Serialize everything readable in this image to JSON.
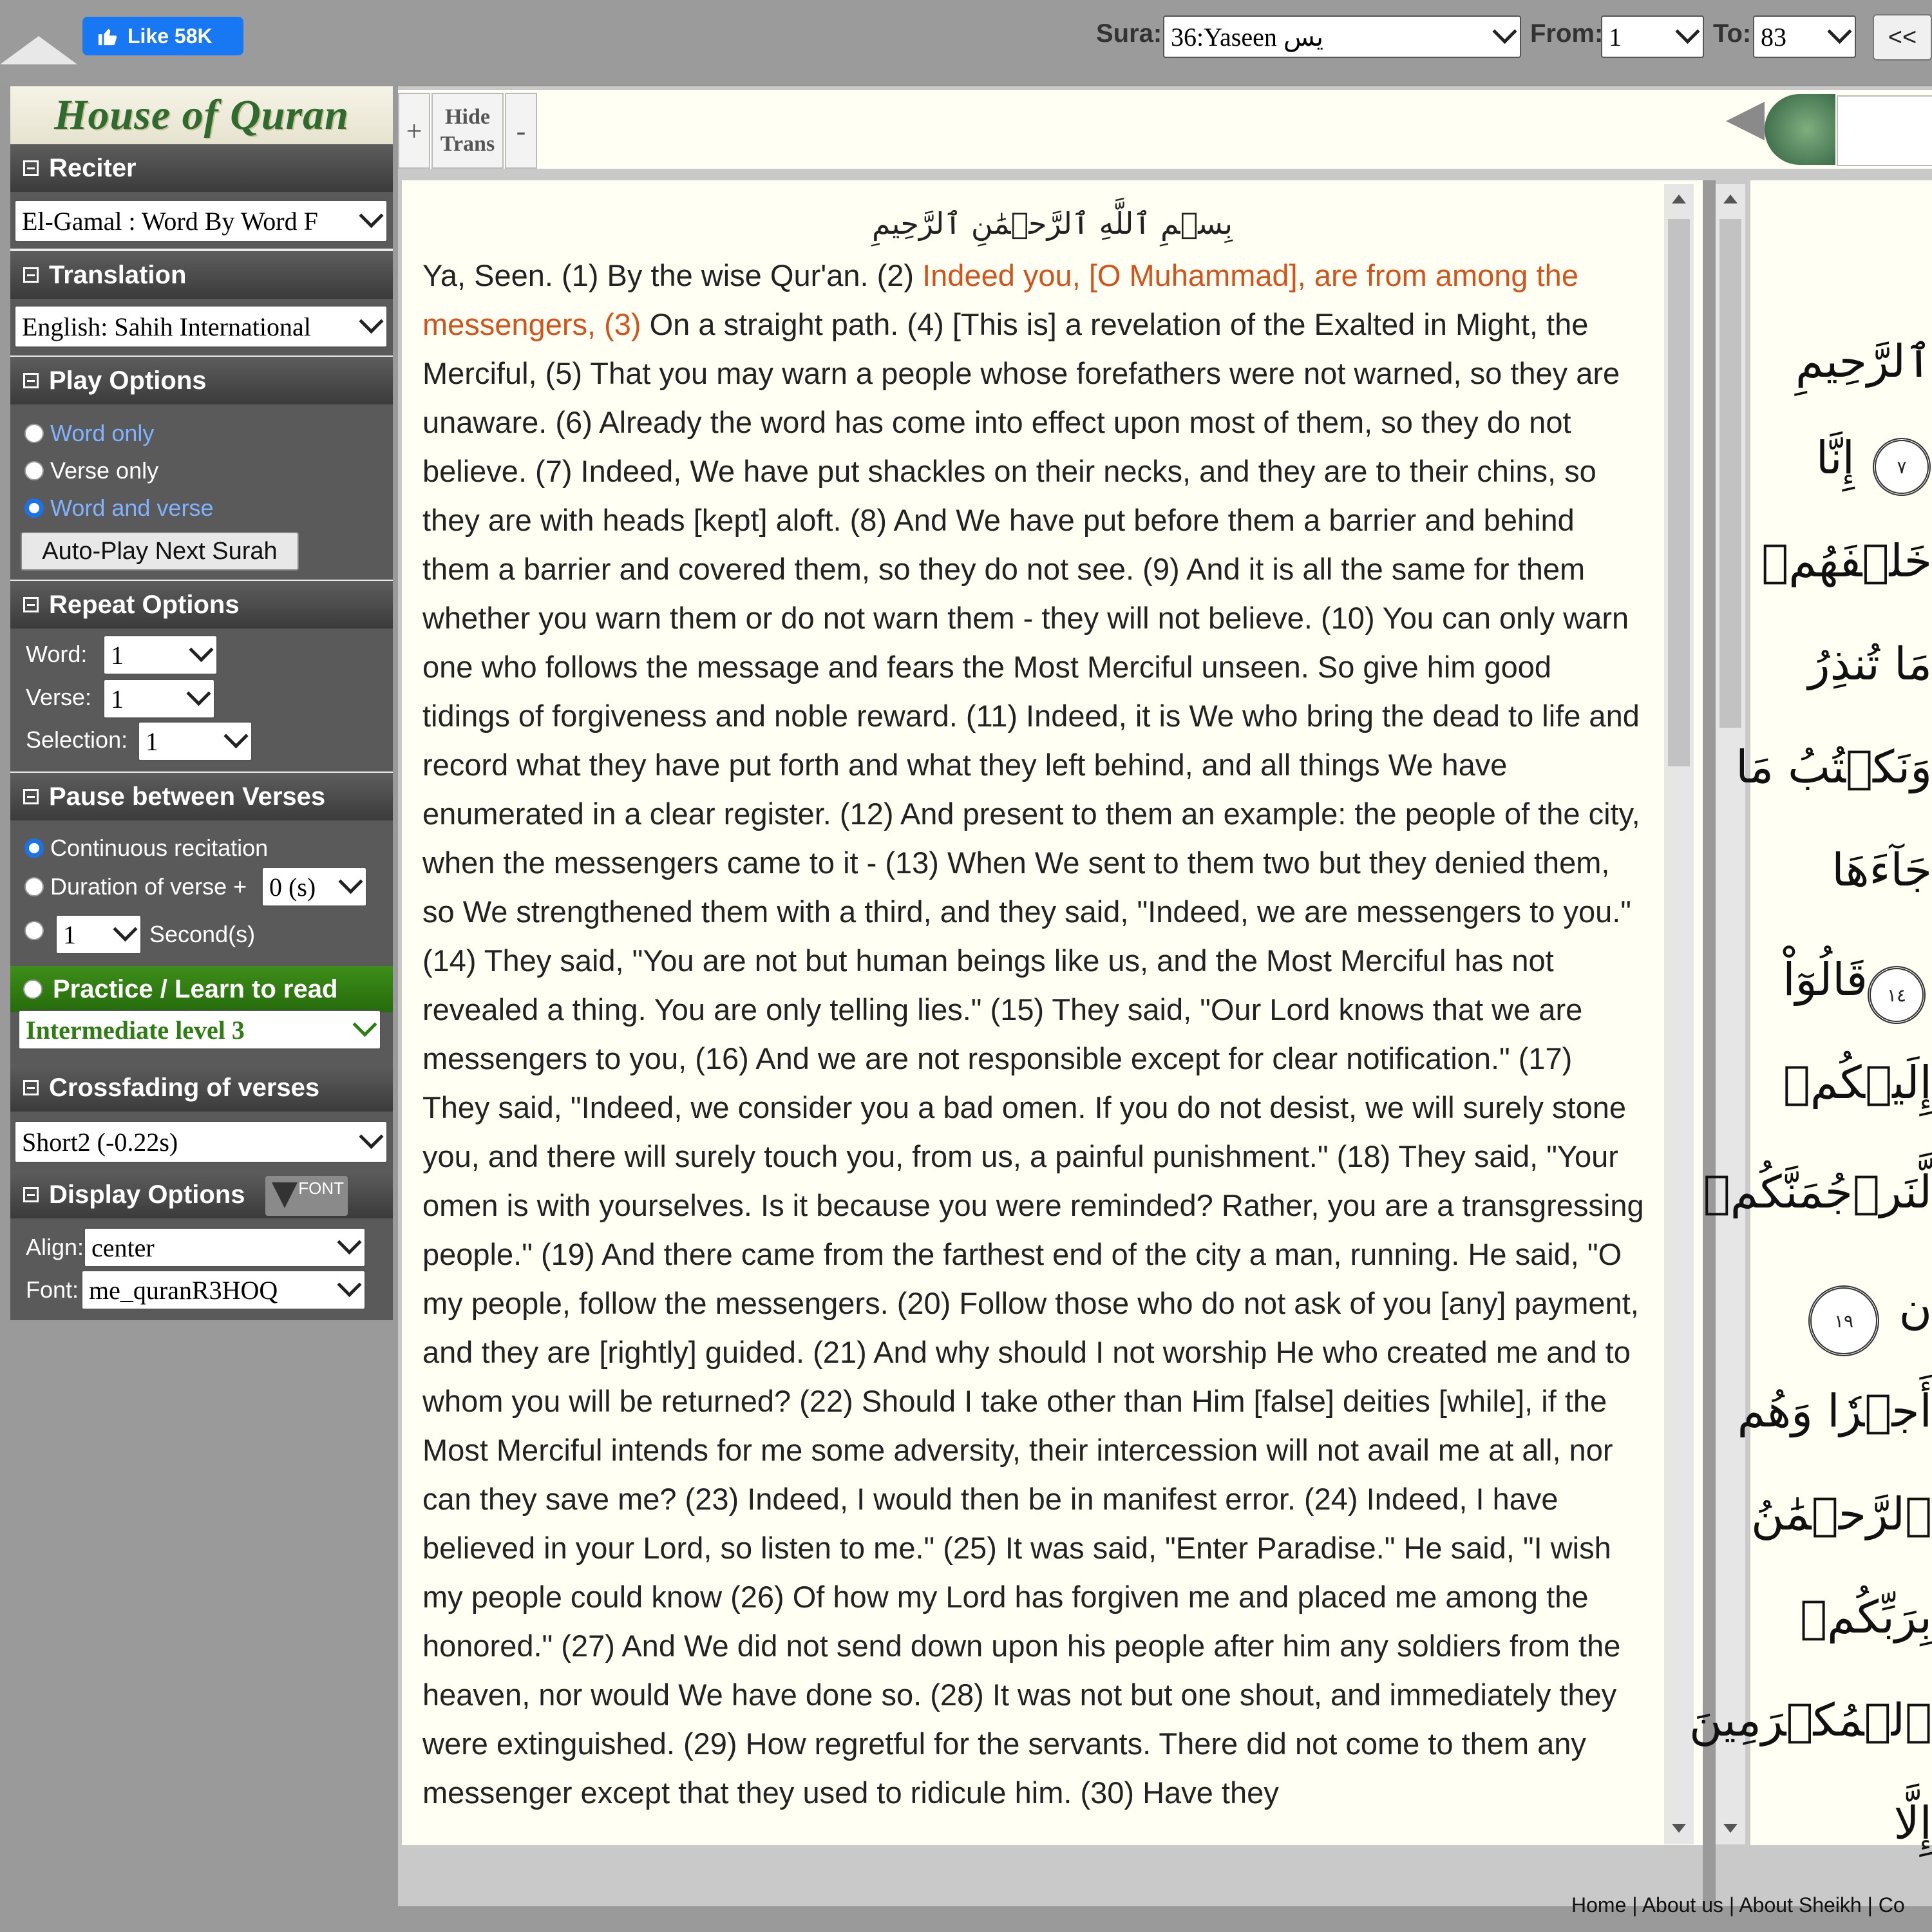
{
  "topbar": {
    "like_label": "Like 58K",
    "sura_label": "Sura:",
    "sura_value": "36:Yaseen يس",
    "from_label": "From:",
    "from_value": "1",
    "to_label": "To:",
    "to_value": "83",
    "prev_label": "<<"
  },
  "sidebar": {
    "logo": "House of Quran",
    "reciter": {
      "title": "Reciter",
      "value": "El-Gamal : Word By Word F"
    },
    "translation": {
      "title": "Translation",
      "value": "English: Sahih International"
    },
    "play": {
      "title": "Play Options",
      "options": [
        "Word only",
        "Verse only",
        "Word and verse"
      ],
      "autoplay": "Auto-Play Next Surah"
    },
    "repeat": {
      "title": "Repeat Options",
      "word_label": "Word:",
      "word_value": "1",
      "verse_label": "Verse:",
      "verse_value": "1",
      "selection_label": "Selection:",
      "selection_value": "1"
    },
    "pause": {
      "title": "Pause between Verses",
      "continuous": "Continuous recitation",
      "duration": "Duration of verse +",
      "duration_value": "0 (s)",
      "seconds_value": "1",
      "seconds_label": "Second(s)"
    },
    "practice": {
      "title": "Practice / Learn to read",
      "value": "Intermediate level 3"
    },
    "crossfade": {
      "title": "Crossfading of verses",
      "value": "Short2 (-0.22s)"
    },
    "display": {
      "title": "Display Options",
      "font_badge": "FONT",
      "align_label": "Align:",
      "align_value": "center",
      "font_label": "Font:",
      "font_value": "me_quranR3HOQ"
    }
  },
  "toolbar": {
    "plus": "+",
    "hide_trans_1": "Hide",
    "hide_trans_2": "Trans",
    "minus": "-"
  },
  "content": {
    "basmala": "بِسۡمِ ٱللَّهِ ٱلرَّحۡمَٰنِ ٱلرَّحِيمِ",
    "v1": "Ya, Seen. (1) By the wise Qur'an. (2) ",
    "v3": "Indeed you, [O Muhammad], are from among the messengers, (3)",
    "rest": " On a straight path. (4) [This is] a revelation of the Exalted in Might, the Merciful, (5) That you may warn a people whose forefathers were not warned, so they are unaware. (6) Already the word has come into effect upon most of them, so they do not believe. (7) Indeed, We have put shackles on their necks, and they are to their chins, so they are with heads [kept] aloft. (8) And We have put before them a barrier and behind them a barrier and covered them, so they do not see. (9) And it is all the same for them whether you warn them or do not warn them - they will not believe. (10) You can only warn one who follows the message and fears the Most Merciful unseen. So give him good tidings of forgiveness and noble reward. (11) Indeed, it is We who bring the dead to life and record what they have put forth and what they left behind, and all things We have enumerated in a clear register. (12) And present to them an example: the people of the city, when the messengers came to it - (13) When We sent to them two but they denied them, so We strengthened them with a third, and they said, \"Indeed, we are messengers to you.\" (14) They said, \"You are not but human beings like us, and the Most Merciful has not revealed a thing. You are only telling lies.\" (15) They said, \"Our Lord knows that we are messengers to you, (16) And we are not responsible except for clear notification.\" (17) They said, \"Indeed, we consider you a bad omen. If you do not desist, we will surely stone you, and there will surely touch you, from us, a painful punishment.\" (18) They said, \"Your omen is with yourselves. Is it because you were reminded? Rather, you are a transgressing people.\" (19) And there came from the farthest end of the city a man, running. He said, \"O my people, follow the messengers. (20) Follow those who do not ask of you [any] payment, and they are [rightly] guided. (21) And why should I not worship He who created me and to whom you will be returned? (22) Should I take other than Him [false] deities [while], if the Most Merciful intends for me some adversity, their intercession will not avail me at all, nor can they save me? (23) Indeed, I would then be in manifest error. (24) Indeed, I have believed in your Lord, so listen to me.\" (25) It was said, \"Enter Paradise.\" He said, \"I wish my people could know (26) Of how my Lord has forgiven me and placed me among the honored.\" (27) And We did not send down upon his people after him any soldiers from the heaven, nor would We have done so. (28) It was not but one shout, and immediately they were extinguished. (29) How regretful for the servants. There did not come to them any messenger except that they used to ridicule him. (30) Have they"
  },
  "arabic": {
    "lines": [
      "ٱلرَّحِيمِ",
      "إِنَّا",
      "خَلۡفَهُمۡ",
      "مَا تُنذِرُ",
      "وَنَكۡتُبُ مَا",
      "جَآءَهَا",
      "قَالُوٓاْ",
      "إِلَيۡكُمۡ",
      "لَّنَرۡجُمَنَّكُمۡ",
      "ن",
      "أَجۡرٗا وَهُم",
      "ٱلرَّحۡمَٰنُ",
      "بِرَبِّكُمۡ",
      "ٱلۡمُكۡرَمِينَ",
      "إِلَّا"
    ],
    "marks": [
      "٧",
      "١٤",
      "١٩"
    ]
  },
  "footer": {
    "text": "Home | About us | About Sheikh | Co"
  },
  "colors": {
    "accent": "#d2541b",
    "header_bg": "#4a4a4a",
    "practice_green": "#2e7d12",
    "facebook": "#1877f2"
  }
}
